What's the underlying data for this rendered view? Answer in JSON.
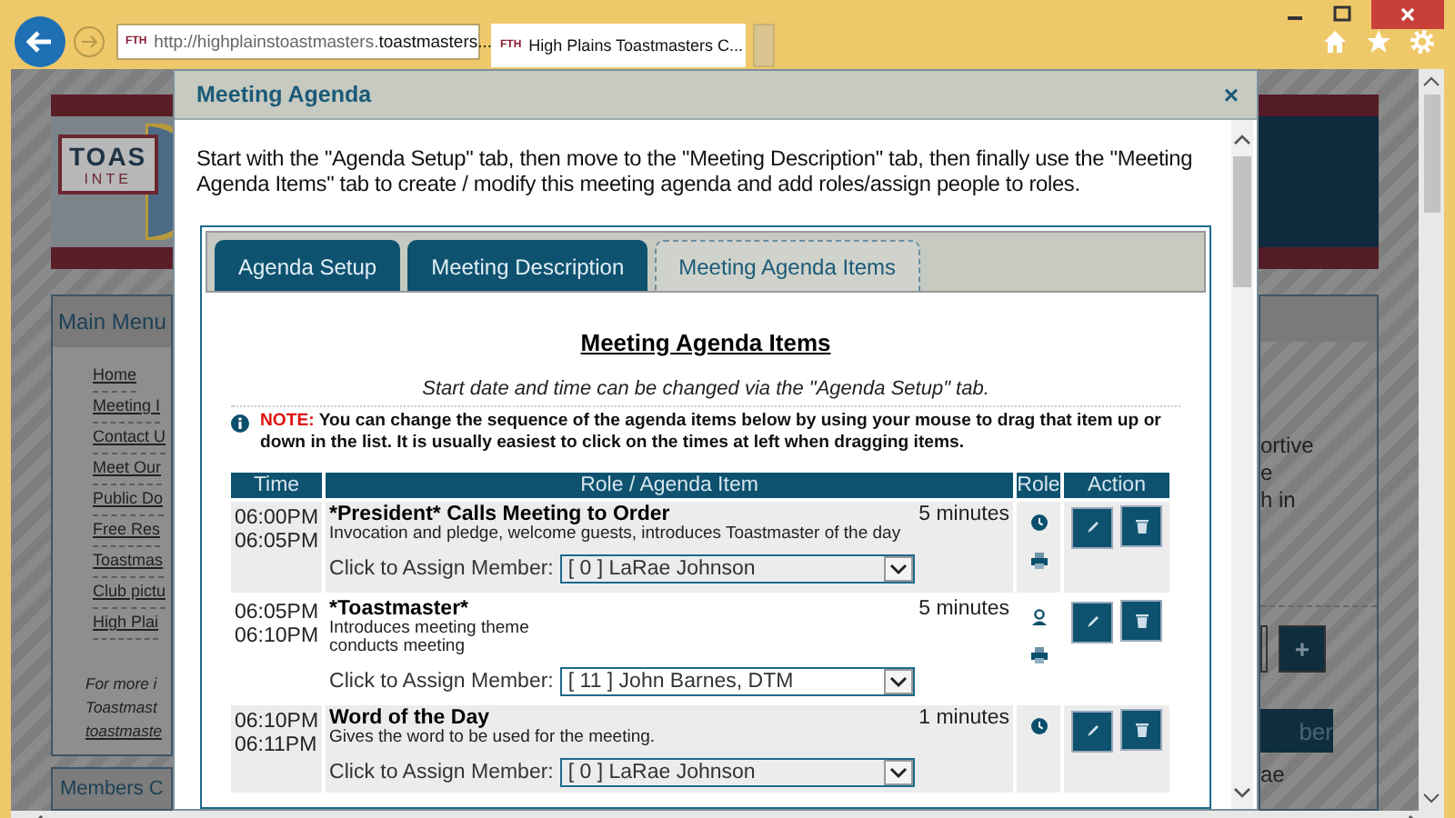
{
  "browser": {
    "address_prefix": "http://highplainstoastmasters.",
    "address_domain": "toastmasters...",
    "site_badge": "FTH",
    "tab_badge": "FTH",
    "tab_title": "High Plains Toastmasters C..."
  },
  "page": {
    "logo_lines": [
      "TOAS",
      "INTE"
    ],
    "main_menu": {
      "title": "Main Menu",
      "items": [
        "Home",
        "Meeting I",
        "Contact U",
        "Meet Our",
        "Public Do",
        "Free Res",
        "Toastmas",
        "Club pictu",
        "High Plai"
      ]
    },
    "info_lines": [
      "For more i",
      "Toastmast",
      "toastmaste"
    ],
    "members_title": "Members C",
    "right_lines": [
      "ortive",
      "e",
      "h in"
    ],
    "plus_button": "+",
    "member_button": "ber",
    "right_tail": "ae"
  },
  "modal": {
    "title": "Meeting Agenda",
    "close": "×",
    "intro": "Start with the \"Agenda Setup\" tab, then move to the \"Meeting Description\" tab, then finally use the \"Meeting Agenda Items\" tab to create / modify this meeting agenda and add roles/assign people to roles.",
    "tabs": [
      {
        "label": "Agenda Setup",
        "selected": false
      },
      {
        "label": "Meeting Description",
        "selected": false
      },
      {
        "label": "Meeting Agenda Items",
        "selected": true
      }
    ],
    "heading": "Meeting Agenda Items",
    "date_note": "Start date and time can be changed via the \"Agenda Setup\" tab.",
    "note_label": "NOTE:",
    "note_text": "You can change the sequence of the agenda items below by using your mouse to drag that item up or down in the list. It is usually easiest to click on the times at left when dragging items.",
    "columns": [
      "Time",
      "Role / Agenda Item",
      "Role",
      "Action"
    ],
    "rows": [
      {
        "start": "06:00PM",
        "end": "06:05PM",
        "title": "*President* Calls Meeting to Order",
        "description": [
          "Invocation and pledge, welcome guests, introduces Toastmaster of the day"
        ],
        "duration": "5 minutes",
        "assign_label": "Click to Assign Member:",
        "member": "[ 0 ] LaRae Johnson",
        "role_icons": [
          {
            "kind": "clock"
          },
          {
            "kind": "printer"
          }
        ]
      },
      {
        "start": "06:05PM",
        "end": "06:10PM",
        "title": "*Toastmaster*",
        "description": [
          "Introduces meeting theme",
          "conducts meeting"
        ],
        "duration": "5 minutes",
        "assign_label": "Click to Assign Member:",
        "member": "[ 11 ] John Barnes, DTM",
        "role_icons": [
          {
            "kind": "person"
          },
          {
            "kind": "printer"
          }
        ]
      },
      {
        "start": "06:10PM",
        "end": "06:11PM",
        "title": "Word of the Day",
        "description": [
          "Gives the word to be used for the meeting."
        ],
        "duration": "1 minutes",
        "assign_label": "Click to Assign Member:",
        "member": "[ 0 ] LaRae Johnson",
        "role_icons": [
          {
            "kind": "clock"
          }
        ]
      }
    ]
  }
}
